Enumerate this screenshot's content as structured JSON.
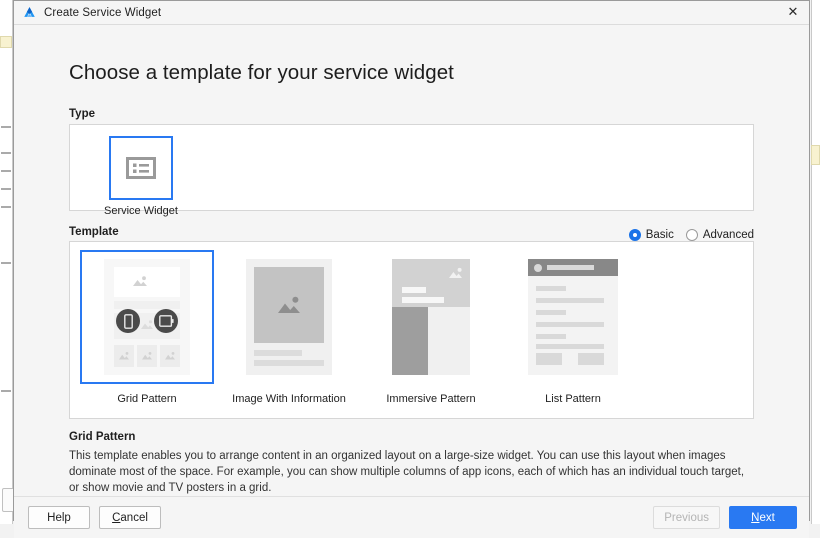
{
  "window": {
    "title": "Create Service Widget",
    "app_icon": "deveco-logo-icon",
    "close_label": "✕"
  },
  "page": {
    "heading": "Choose a template for your service widget"
  },
  "type_section": {
    "label": "Type",
    "cards": [
      {
        "label": "Service Widget",
        "icon": "service-widget-list-icon",
        "selected": true
      }
    ]
  },
  "template_section": {
    "label": "Template",
    "mode_options": [
      {
        "label": "Basic",
        "selected": true
      },
      {
        "label": "Advanced",
        "selected": false
      }
    ],
    "cards": [
      {
        "label": "Grid Pattern",
        "selected": true
      },
      {
        "label": "Image With Information",
        "selected": false
      },
      {
        "label": "Immersive Pattern",
        "selected": false
      },
      {
        "label": "List Pattern",
        "selected": false
      }
    ]
  },
  "description": {
    "title": "Grid Pattern",
    "body": "This template enables you to arrange content in an organized layout on a large-size widget. You can use this layout when images dominate most of the space. For example, you can show multiple columns of app icons, each of which has an individual touch target, or show movie and TV posters in a grid."
  },
  "footer": {
    "help": "Help",
    "cancel_pre": "C",
    "cancel_post": "ancel",
    "previous": "Previous",
    "next_pre": "N",
    "next_post": "ext"
  },
  "colors": {
    "accent": "#2979f2",
    "radio_accent": "#1a73e8",
    "dialog_bg": "#f5f5f5",
    "panel_bg": "#ffffff",
    "border": "#d6d6d6"
  }
}
